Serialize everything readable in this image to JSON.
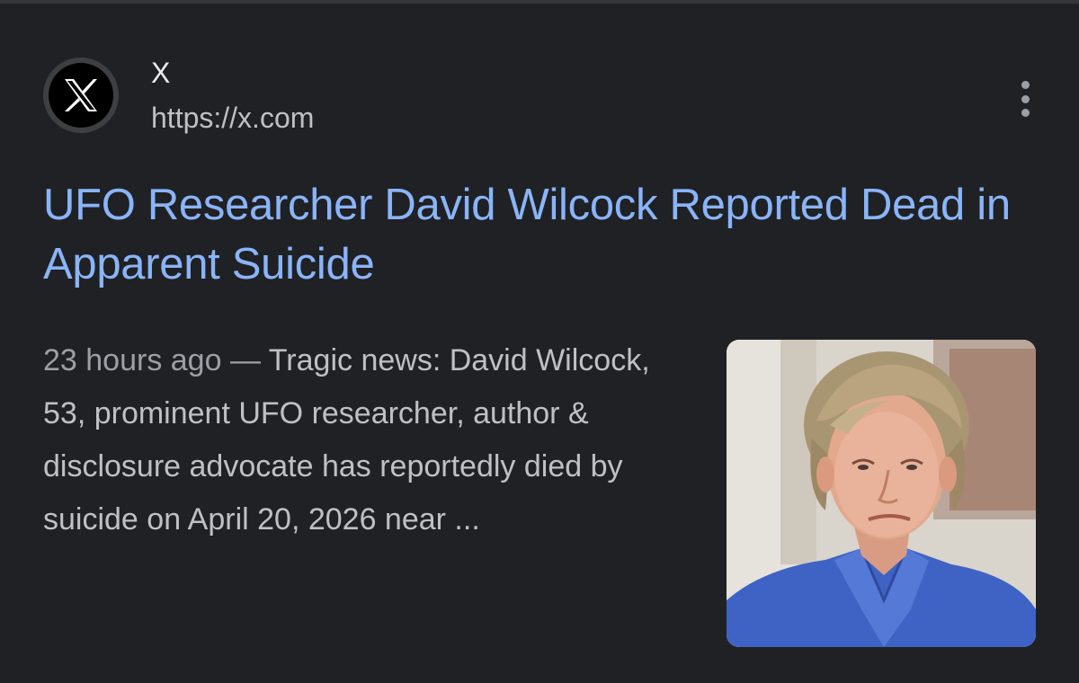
{
  "source": {
    "site_name": "X",
    "url": "https://x.com",
    "favicon_icon": "x-logo-icon",
    "more_icon": "more-vertical-icon"
  },
  "result": {
    "title": "UFO Researcher David Wilcock Reported Dead in Apparent Suicide",
    "date": "23 hours ago",
    "separator": "—",
    "snippet": "Tragic news: David Wilcock, 53, prominent UFO researcher, author & disclosure advocate has reportedly died by suicide on April 20, 2026 near ..."
  },
  "thumbnail": {
    "icon": "person-photo-thumbnail"
  },
  "colors": {
    "background": "#202124",
    "title_link": "#8ab4f8",
    "primary_text": "#e8eaed",
    "secondary_text": "#bdc1c6",
    "muted_text": "#9aa0a6"
  }
}
